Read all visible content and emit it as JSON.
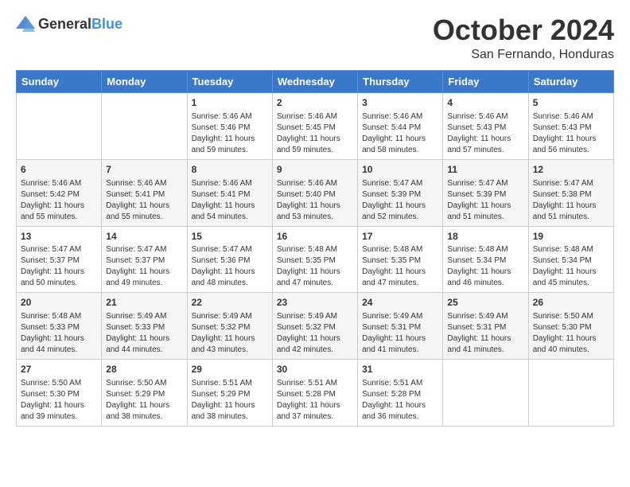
{
  "header": {
    "logo_general": "General",
    "logo_blue": "Blue",
    "title": "October 2024",
    "location": "San Fernando, Honduras"
  },
  "days_of_week": [
    "Sunday",
    "Monday",
    "Tuesday",
    "Wednesday",
    "Thursday",
    "Friday",
    "Saturday"
  ],
  "weeks": [
    [
      {
        "num": "",
        "detail": ""
      },
      {
        "num": "",
        "detail": ""
      },
      {
        "num": "1",
        "detail": "Sunrise: 5:46 AM\nSunset: 5:46 PM\nDaylight: 11 hours and 59 minutes."
      },
      {
        "num": "2",
        "detail": "Sunrise: 5:46 AM\nSunset: 5:45 PM\nDaylight: 11 hours and 59 minutes."
      },
      {
        "num": "3",
        "detail": "Sunrise: 5:46 AM\nSunset: 5:44 PM\nDaylight: 11 hours and 58 minutes."
      },
      {
        "num": "4",
        "detail": "Sunrise: 5:46 AM\nSunset: 5:43 PM\nDaylight: 11 hours and 57 minutes."
      },
      {
        "num": "5",
        "detail": "Sunrise: 5:46 AM\nSunset: 5:43 PM\nDaylight: 11 hours and 56 minutes."
      }
    ],
    [
      {
        "num": "6",
        "detail": "Sunrise: 5:46 AM\nSunset: 5:42 PM\nDaylight: 11 hours and 55 minutes."
      },
      {
        "num": "7",
        "detail": "Sunrise: 5:46 AM\nSunset: 5:41 PM\nDaylight: 11 hours and 55 minutes."
      },
      {
        "num": "8",
        "detail": "Sunrise: 5:46 AM\nSunset: 5:41 PM\nDaylight: 11 hours and 54 minutes."
      },
      {
        "num": "9",
        "detail": "Sunrise: 5:46 AM\nSunset: 5:40 PM\nDaylight: 11 hours and 53 minutes."
      },
      {
        "num": "10",
        "detail": "Sunrise: 5:47 AM\nSunset: 5:39 PM\nDaylight: 11 hours and 52 minutes."
      },
      {
        "num": "11",
        "detail": "Sunrise: 5:47 AM\nSunset: 5:39 PM\nDaylight: 11 hours and 51 minutes."
      },
      {
        "num": "12",
        "detail": "Sunrise: 5:47 AM\nSunset: 5:38 PM\nDaylight: 11 hours and 51 minutes."
      }
    ],
    [
      {
        "num": "13",
        "detail": "Sunrise: 5:47 AM\nSunset: 5:37 PM\nDaylight: 11 hours and 50 minutes."
      },
      {
        "num": "14",
        "detail": "Sunrise: 5:47 AM\nSunset: 5:37 PM\nDaylight: 11 hours and 49 minutes."
      },
      {
        "num": "15",
        "detail": "Sunrise: 5:47 AM\nSunset: 5:36 PM\nDaylight: 11 hours and 48 minutes."
      },
      {
        "num": "16",
        "detail": "Sunrise: 5:48 AM\nSunset: 5:35 PM\nDaylight: 11 hours and 47 minutes."
      },
      {
        "num": "17",
        "detail": "Sunrise: 5:48 AM\nSunset: 5:35 PM\nDaylight: 11 hours and 47 minutes."
      },
      {
        "num": "18",
        "detail": "Sunrise: 5:48 AM\nSunset: 5:34 PM\nDaylight: 11 hours and 46 minutes."
      },
      {
        "num": "19",
        "detail": "Sunrise: 5:48 AM\nSunset: 5:34 PM\nDaylight: 11 hours and 45 minutes."
      }
    ],
    [
      {
        "num": "20",
        "detail": "Sunrise: 5:48 AM\nSunset: 5:33 PM\nDaylight: 11 hours and 44 minutes."
      },
      {
        "num": "21",
        "detail": "Sunrise: 5:49 AM\nSunset: 5:33 PM\nDaylight: 11 hours and 44 minutes."
      },
      {
        "num": "22",
        "detail": "Sunrise: 5:49 AM\nSunset: 5:32 PM\nDaylight: 11 hours and 43 minutes."
      },
      {
        "num": "23",
        "detail": "Sunrise: 5:49 AM\nSunset: 5:32 PM\nDaylight: 11 hours and 42 minutes."
      },
      {
        "num": "24",
        "detail": "Sunrise: 5:49 AM\nSunset: 5:31 PM\nDaylight: 11 hours and 41 minutes."
      },
      {
        "num": "25",
        "detail": "Sunrise: 5:49 AM\nSunset: 5:31 PM\nDaylight: 11 hours and 41 minutes."
      },
      {
        "num": "26",
        "detail": "Sunrise: 5:50 AM\nSunset: 5:30 PM\nDaylight: 11 hours and 40 minutes."
      }
    ],
    [
      {
        "num": "27",
        "detail": "Sunrise: 5:50 AM\nSunset: 5:30 PM\nDaylight: 11 hours and 39 minutes."
      },
      {
        "num": "28",
        "detail": "Sunrise: 5:50 AM\nSunset: 5:29 PM\nDaylight: 11 hours and 38 minutes."
      },
      {
        "num": "29",
        "detail": "Sunrise: 5:51 AM\nSunset: 5:29 PM\nDaylight: 11 hours and 38 minutes."
      },
      {
        "num": "30",
        "detail": "Sunrise: 5:51 AM\nSunset: 5:28 PM\nDaylight: 11 hours and 37 minutes."
      },
      {
        "num": "31",
        "detail": "Sunrise: 5:51 AM\nSunset: 5:28 PM\nDaylight: 11 hours and 36 minutes."
      },
      {
        "num": "",
        "detail": ""
      },
      {
        "num": "",
        "detail": ""
      }
    ]
  ]
}
